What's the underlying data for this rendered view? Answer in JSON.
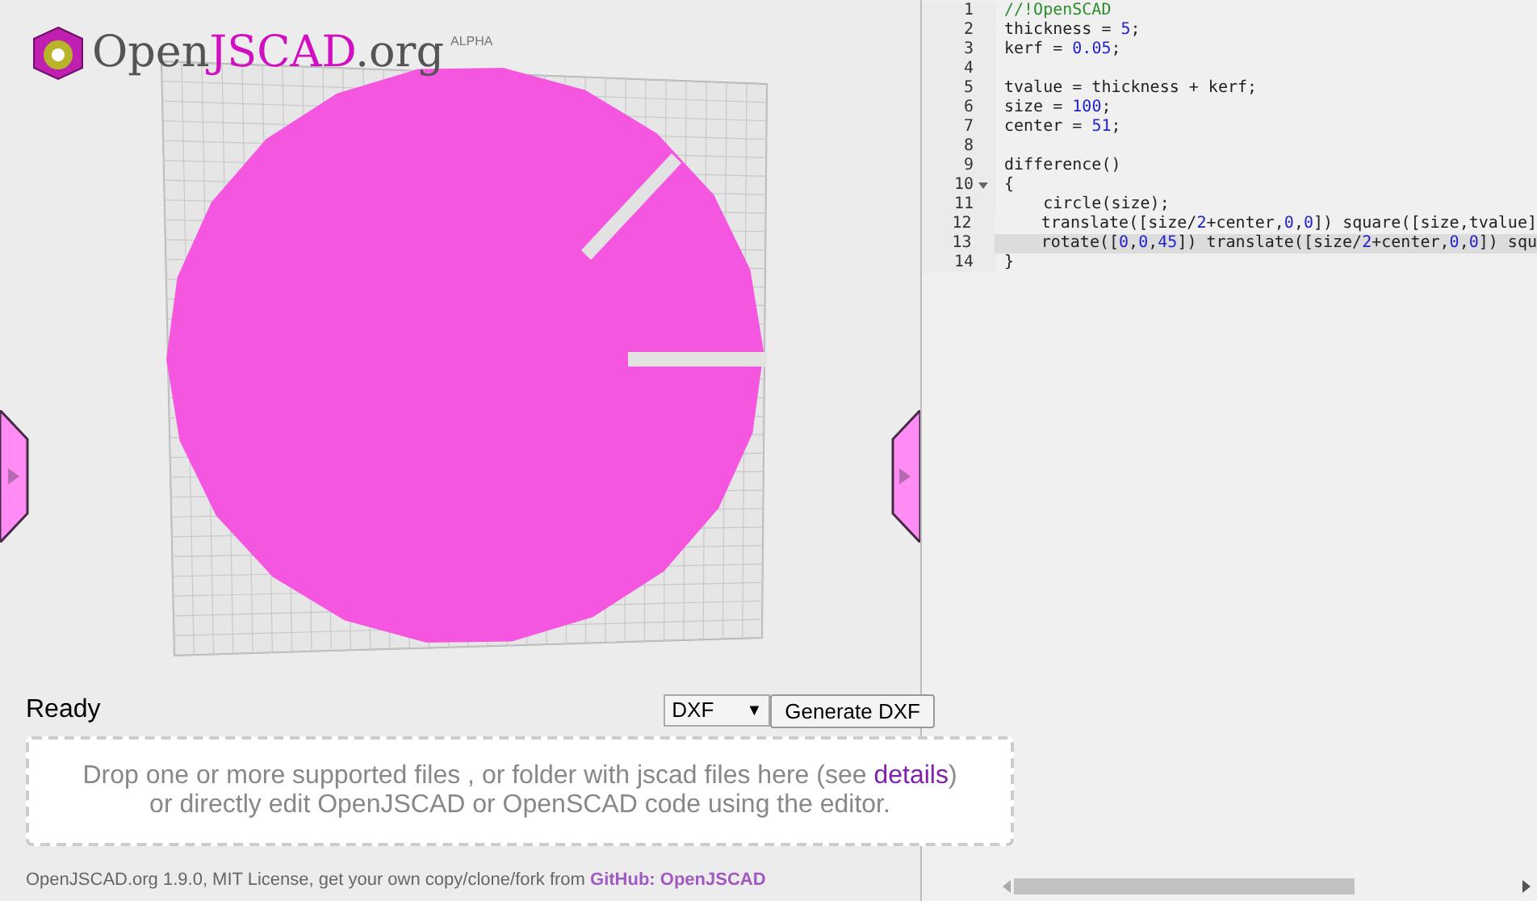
{
  "logo": {
    "name_plain": "Open",
    "name_accent": "JSCAD",
    "name_suffix": ".org",
    "badge": "ALPHA"
  },
  "status": "Ready",
  "format_select": {
    "value": "DXF",
    "caret": "▼"
  },
  "generate_button": "Generate DXF",
  "drop_zone": {
    "line_1": "Drop one or more supported files , or folder with jscad files here (see ",
    "link": "details",
    "line_1_end": ")",
    "line_2": "or directly edit OpenJSCAD or OpenSCAD code using the editor."
  },
  "footer": {
    "text": "OpenJSCAD.org 1.9.0, MIT License, get your own copy/clone/fork from ",
    "link": "GitHub: OpenJSCAD"
  },
  "editor": {
    "lines": [
      {
        "number": "1",
        "active": false,
        "foldable": false,
        "tokens": [
          {
            "kind": "comment",
            "text": "//!OpenSCAD"
          }
        ]
      },
      {
        "number": "2",
        "active": false,
        "foldable": false,
        "tokens": [
          {
            "kind": "plain",
            "text": "thickness = "
          },
          {
            "kind": "number",
            "text": "5"
          },
          {
            "kind": "plain",
            "text": ";"
          }
        ]
      },
      {
        "number": "3",
        "active": false,
        "foldable": false,
        "tokens": [
          {
            "kind": "plain",
            "text": "kerf = "
          },
          {
            "kind": "number",
            "text": "0.05"
          },
          {
            "kind": "plain",
            "text": ";"
          }
        ]
      },
      {
        "number": "4",
        "active": false,
        "foldable": false
      },
      {
        "number": "5",
        "active": false,
        "foldable": false,
        "tokens": [
          {
            "kind": "plain",
            "text": "tvalue = thickness + kerf;"
          }
        ]
      },
      {
        "number": "6",
        "active": false,
        "foldable": false,
        "tokens": [
          {
            "kind": "plain",
            "text": "size = "
          },
          {
            "kind": "number",
            "text": "100"
          },
          {
            "kind": "plain",
            "text": ";"
          }
        ]
      },
      {
        "number": "7",
        "active": false,
        "foldable": false,
        "tokens": [
          {
            "kind": "plain",
            "text": "center = "
          },
          {
            "kind": "number",
            "text": "51"
          },
          {
            "kind": "plain",
            "text": ";"
          }
        ]
      },
      {
        "number": "8",
        "active": false,
        "foldable": false
      },
      {
        "number": "9",
        "active": false,
        "foldable": false,
        "tokens": [
          {
            "kind": "plain",
            "text": "difference()"
          }
        ]
      },
      {
        "number": "10",
        "active": false,
        "foldable": true,
        "tokens": [
          {
            "kind": "plain",
            "text": "{"
          }
        ]
      },
      {
        "number": "11",
        "active": false,
        "foldable": false,
        "tokens": [
          {
            "kind": "plain",
            "text": "    circle(size);"
          }
        ]
      },
      {
        "number": "12",
        "active": false,
        "foldable": false,
        "tokens": [
          {
            "kind": "plain",
            "text": "    translate([size/"
          },
          {
            "kind": "number",
            "text": "2"
          },
          {
            "kind": "plain",
            "text": "+center,"
          },
          {
            "kind": "number",
            "text": "0"
          },
          {
            "kind": "plain",
            "text": ","
          },
          {
            "kind": "number",
            "text": "0"
          },
          {
            "kind": "plain",
            "text": "]) square([size,tvalue]"
          }
        ]
      },
      {
        "number": "13",
        "active": true,
        "foldable": false,
        "tokens": [
          {
            "kind": "plain",
            "text": "    rotate(["
          },
          {
            "kind": "number",
            "text": "0"
          },
          {
            "kind": "plain",
            "text": ","
          },
          {
            "kind": "number",
            "text": "0"
          },
          {
            "kind": "plain",
            "text": ","
          },
          {
            "kind": "number",
            "text": "45"
          },
          {
            "kind": "plain",
            "text": "]) translate([size/"
          },
          {
            "kind": "number",
            "text": "2"
          },
          {
            "kind": "plain",
            "text": "+center,"
          },
          {
            "kind": "number",
            "text": "0"
          },
          {
            "kind": "plain",
            "text": ","
          },
          {
            "kind": "number",
            "text": "0"
          },
          {
            "kind": "plain",
            "text": "]) squ"
          }
        ]
      },
      {
        "number": "14",
        "active": false,
        "foldable": false,
        "tokens": [
          {
            "kind": "plain",
            "text": "}"
          }
        ]
      }
    ]
  }
}
